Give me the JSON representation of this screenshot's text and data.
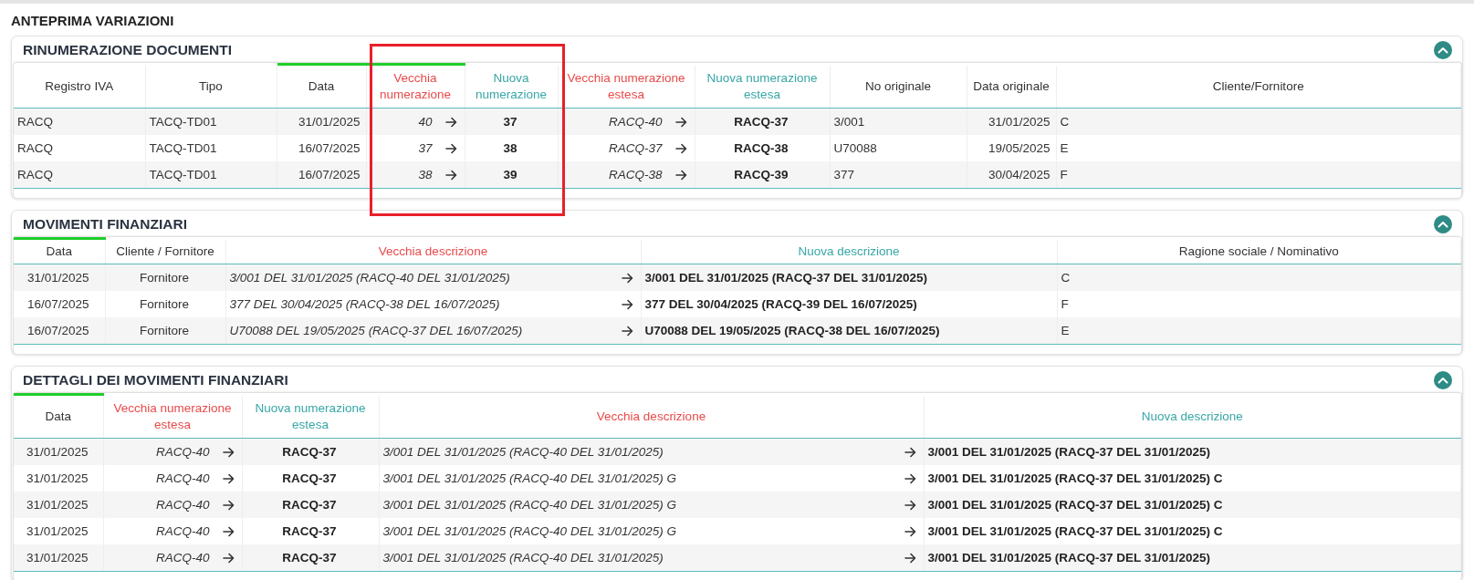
{
  "page_title": "ANTEPRIMA VARIAZIONI",
  "sections": [
    {
      "title": "RINUMERAZIONE DOCUMENTI",
      "expanded": true,
      "columns": [
        {
          "label": "Registro IVA",
          "kind": "plain",
          "sorted": false
        },
        {
          "label": "Tipo",
          "kind": "plain",
          "sorted": false
        },
        {
          "label": "Data",
          "kind": "plain",
          "sorted": true
        },
        {
          "label": "Vecchia numerazione",
          "kind": "old",
          "sorted": true
        },
        {
          "label": "Nuova numerazione",
          "kind": "new",
          "sorted": false
        },
        {
          "label": "Vecchia numerazione estesa",
          "kind": "old",
          "sorted": false
        },
        {
          "label": "Nuova numerazione estesa",
          "kind": "new",
          "sorted": false
        },
        {
          "label": "No originale",
          "kind": "plain",
          "sorted": false
        },
        {
          "label": "Data originale",
          "kind": "plain",
          "sorted": false
        },
        {
          "label": "Cliente/Fornitore",
          "kind": "plain",
          "sorted": false
        }
      ],
      "rows": [
        [
          "RACQ",
          "TACQ-TD01",
          "31/01/2025",
          "40",
          "37",
          "RACQ-40",
          "RACQ-37",
          "3/001",
          "31/01/2025",
          "C"
        ],
        [
          "RACQ",
          "TACQ-TD01",
          "16/07/2025",
          "37",
          "38",
          "RACQ-37",
          "RACQ-38",
          "U70088",
          "19/05/2025",
          "E"
        ],
        [
          "RACQ",
          "TACQ-TD01",
          "16/07/2025",
          "38",
          "39",
          "RACQ-38",
          "RACQ-39",
          "377",
          "30/04/2025",
          "F"
        ]
      ]
    },
    {
      "title": "MOVIMENTI FINANZIARI",
      "expanded": true,
      "columns": [
        {
          "label": "Data",
          "kind": "plain",
          "sorted": true
        },
        {
          "label": "Cliente / Fornitore",
          "kind": "plain",
          "sorted": false
        },
        {
          "label": "Vecchia descrizione",
          "kind": "old",
          "sorted": false
        },
        {
          "label": "Nuova descrizione",
          "kind": "new",
          "sorted": false
        },
        {
          "label": "Ragione sociale / Nominativo",
          "kind": "plain",
          "sorted": false
        }
      ],
      "rows": [
        [
          "31/01/2025",
          "Fornitore",
          "3/001 DEL 31/01/2025 (RACQ-40 DEL 31/01/2025)",
          "3/001 DEL 31/01/2025 (RACQ-37 DEL 31/01/2025)",
          "C"
        ],
        [
          "16/07/2025",
          "Fornitore",
          "377 DEL 30/04/2025 (RACQ-38 DEL 16/07/2025)",
          "377 DEL 30/04/2025 (RACQ-39 DEL 16/07/2025)",
          "F"
        ],
        [
          "16/07/2025",
          "Fornitore",
          "U70088 DEL 19/05/2025 (RACQ-37 DEL 16/07/2025)",
          "U70088 DEL 19/05/2025 (RACQ-38 DEL 16/07/2025)",
          "E"
        ]
      ]
    },
    {
      "title": "DETTAGLI DEI MOVIMENTI FINANZIARI",
      "expanded": true,
      "columns": [
        {
          "label": "Data",
          "kind": "plain",
          "sorted": true
        },
        {
          "label": "Vecchia numerazione estesa",
          "kind": "old",
          "sorted": false
        },
        {
          "label": "Nuova numerazione estesa",
          "kind": "new",
          "sorted": false
        },
        {
          "label": "Vecchia descrizione",
          "kind": "old",
          "sorted": false
        },
        {
          "label": "Nuova descrizione",
          "kind": "new",
          "sorted": false
        }
      ],
      "rows": [
        [
          "31/01/2025",
          "RACQ-40",
          "RACQ-37",
          "3/001 DEL 31/01/2025 (RACQ-40 DEL 31/01/2025)",
          "3/001 DEL 31/01/2025 (RACQ-37 DEL 31/01/2025)"
        ],
        [
          "31/01/2025",
          "RACQ-40",
          "RACQ-37",
          "3/001 DEL 31/01/2025 (RACQ-40 DEL 31/01/2025) G",
          "3/001 DEL 31/01/2025 (RACQ-37 DEL 31/01/2025) C"
        ],
        [
          "31/01/2025",
          "RACQ-40",
          "RACQ-37",
          "3/001 DEL 31/01/2025 (RACQ-40 DEL 31/01/2025) G",
          "3/001 DEL 31/01/2025 (RACQ-37 DEL 31/01/2025) C"
        ],
        [
          "31/01/2025",
          "RACQ-40",
          "RACQ-37",
          "3/001 DEL 31/01/2025 (RACQ-40 DEL 31/01/2025) G",
          "3/001 DEL 31/01/2025 (RACQ-37 DEL 31/01/2025) C"
        ],
        [
          "31/01/2025",
          "RACQ-40",
          "RACQ-37",
          "3/001 DEL 31/01/2025 (RACQ-40 DEL 31/01/2025)",
          "3/001 DEL 31/01/2025 (RACQ-37 DEL 31/01/2025)"
        ]
      ]
    }
  ]
}
